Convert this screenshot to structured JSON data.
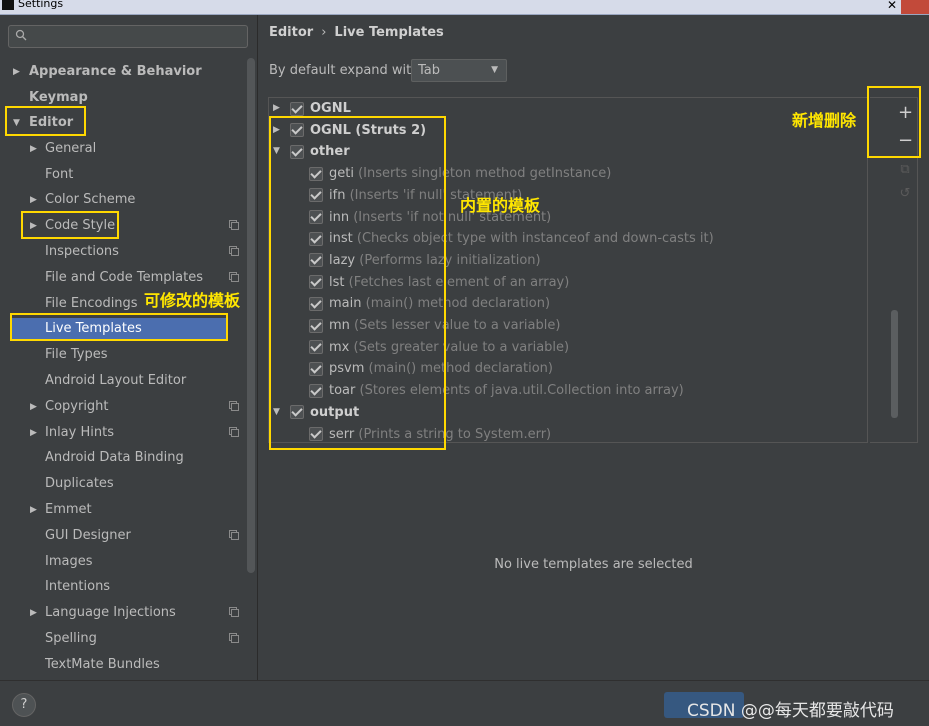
{
  "window": {
    "title": "Settings",
    "close_symbol": "✕"
  },
  "search": {
    "placeholder": ""
  },
  "tree": [
    {
      "label": "Appearance & Behavior",
      "arrow": "▶"
    },
    {
      "label": "Keymap"
    },
    {
      "label": "Editor",
      "arrow": "▼"
    },
    {
      "label": "General",
      "arrow": "▶"
    },
    {
      "label": "Font"
    },
    {
      "label": "Color Scheme",
      "arrow": "▶"
    },
    {
      "label": "Code Style",
      "arrow": "▶"
    },
    {
      "label": "Inspections"
    },
    {
      "label": "File and Code Templates"
    },
    {
      "label": "File Encodings"
    },
    {
      "label": "Live Templates"
    },
    {
      "label": "File Types"
    },
    {
      "label": "Android Layout Editor"
    },
    {
      "label": "Copyright",
      "arrow": "▶"
    },
    {
      "label": "Inlay Hints",
      "arrow": "▶"
    },
    {
      "label": "Android Data Binding"
    },
    {
      "label": "Duplicates"
    },
    {
      "label": "Emmet",
      "arrow": "▶"
    },
    {
      "label": "GUI Designer"
    },
    {
      "label": "Images"
    },
    {
      "label": "Intentions"
    },
    {
      "label": "Language Injections",
      "arrow": "▶"
    },
    {
      "label": "Spelling"
    },
    {
      "label": "TextMate Bundles"
    }
  ],
  "breadcrumb": {
    "parent": "Editor",
    "separator": "›",
    "current": "Live Templates"
  },
  "expand": {
    "label": "By default expand with",
    "value": "Tab"
  },
  "templates": [
    {
      "name": "OGNL",
      "arrow": "▶"
    },
    {
      "name": "OGNL (Struts 2)",
      "arrow": "▶"
    },
    {
      "name": "other",
      "arrow": "▼"
    },
    {
      "name": "geti",
      "desc": "(Inserts singleton method getInstance)"
    },
    {
      "name": "ifn",
      "desc": "(Inserts 'if null' statement)"
    },
    {
      "name": "inn",
      "desc": "(Inserts 'if not null' statement)"
    },
    {
      "name": "inst",
      "desc": "(Checks object type with instanceof and down-casts it)"
    },
    {
      "name": "lazy",
      "desc": "(Performs lazy initialization)"
    },
    {
      "name": "lst",
      "desc": "(Fetches last element of an array)"
    },
    {
      "name": "main",
      "desc": "(main() method declaration)"
    },
    {
      "name": "mn",
      "desc": "(Sets lesser value to a variable)"
    },
    {
      "name": "mx",
      "desc": "(Sets greater value to a variable)"
    },
    {
      "name": "psvm",
      "desc": "(main() method declaration)"
    },
    {
      "name": "toar",
      "desc": "(Stores elements of java.util.Collection into array)"
    },
    {
      "name": "output",
      "arrow": "▼"
    },
    {
      "name": "serr",
      "desc": "(Prints a string to System.err)"
    }
  ],
  "toolbar": {
    "add": "+",
    "remove": "−"
  },
  "empty_message": "No live templates are selected",
  "annotations": {
    "add_remove": "新增删除",
    "builtin": "内置的模板",
    "editable": "可修改的模板"
  },
  "help": "?",
  "watermark": "CSDN @@每天都要敲代码",
  "colors": {
    "accent": "#4b6eaf",
    "highlight": "#ffd800"
  }
}
